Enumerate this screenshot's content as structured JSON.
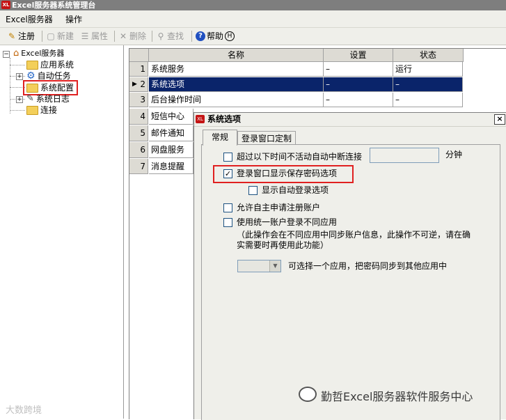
{
  "window": {
    "title": "Excel服务器系统管理台",
    "icon": "excel-server-icon"
  },
  "menu": [
    "Excel服务器",
    "操作"
  ],
  "toolbar": [
    {
      "label": "注册",
      "icon": "register-icon",
      "enabled": true
    },
    {
      "label": "新建",
      "icon": "new-icon",
      "enabled": false
    },
    {
      "label": "属性",
      "icon": "properties-icon",
      "enabled": false
    },
    {
      "label": "删除",
      "icon": "delete-icon",
      "enabled": false
    },
    {
      "label": "查找",
      "icon": "search-icon",
      "enabled": false
    },
    {
      "label": "帮助",
      "shortcut": "H",
      "icon": "help-icon",
      "enabled": true
    }
  ],
  "tree": {
    "root": "Excel服务器",
    "items": [
      "应用系统",
      "自动任务",
      "系统配置",
      "系统日志",
      "连接"
    ],
    "selected": "系统配置"
  },
  "grid": {
    "columns": [
      "名称",
      "设置",
      "状态"
    ],
    "rows": [
      {
        "num": "1",
        "name": "系统服务",
        "setting": "–",
        "status": "运行"
      },
      {
        "num": "2",
        "name": "系统选项",
        "setting": "–",
        "status": "–"
      },
      {
        "num": "3",
        "name": "后台操作时间",
        "setting": "–",
        "status": "–"
      },
      {
        "num": "4",
        "name": "短信中心"
      },
      {
        "num": "5",
        "name": "邮件通知"
      },
      {
        "num": "6",
        "name": "网盘服务"
      },
      {
        "num": "7",
        "name": "消息提醒"
      }
    ],
    "selected_row": "2"
  },
  "dialog": {
    "title": "系统选项",
    "close": "×",
    "tabs": [
      "常规",
      "登录窗口定制"
    ],
    "active_tab": "常规",
    "options": {
      "auto_disconnect": {
        "label": "超过以下时间不活动自动中断连接",
        "checked": false,
        "unit": "分钟",
        "value": ""
      },
      "show_save_password": {
        "label": "登录窗口显示保存密码选项",
        "checked": true
      },
      "show_auto_login": {
        "label": "显示自动登录选项",
        "checked": false
      },
      "self_register": {
        "label": "允许自主申请注册账户",
        "checked": false
      },
      "unified_account": {
        "label": "使用统一账户登录不同应用",
        "checked": false,
        "note_line1": "（此操作会在不同应用中同步账户信息，此操作不可逆，请在确",
        "note_line2": "实需要时再使用此功能）"
      },
      "sync_password": {
        "label": "可选择一个应用，把密码同步到其他应用中",
        "value": ""
      }
    }
  },
  "watermarks": [
    "勤哲Excel服务器软件服务中心",
    "大数跨境"
  ]
}
